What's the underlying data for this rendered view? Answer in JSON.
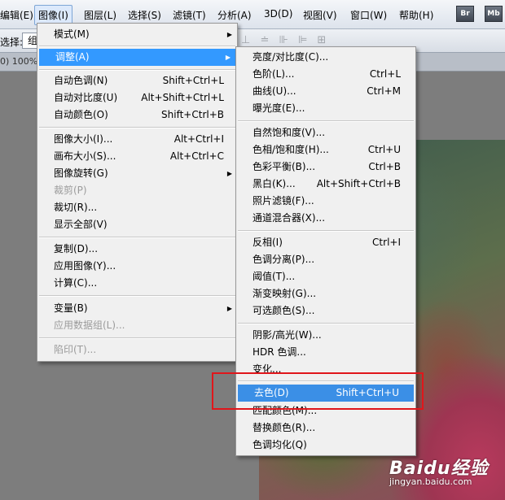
{
  "menubar": {
    "items": [
      "编辑(E)",
      "图像(I)",
      "图层(L)",
      "选择(S)",
      "滤镜(T)",
      "分析(A)",
      "3D(D)",
      "视图(V)",
      "窗口(W)",
      "帮助(H)"
    ],
    "icons": [
      "Br",
      "Mb"
    ]
  },
  "optbar": {
    "label": "选择:",
    "select_value": "组"
  },
  "tabstrip": {
    "zoom": "0) 100%"
  },
  "image_menu": {
    "items": [
      {
        "label": "模式(M)",
        "submenu": true
      },
      {
        "label": "调整(A)",
        "submenu": true,
        "highlighted": true
      },
      {
        "label": "自动色调(N)",
        "shortcut": "Shift+Ctrl+L"
      },
      {
        "label": "自动对比度(U)",
        "shortcut": "Alt+Shift+Ctrl+L"
      },
      {
        "label": "自动颜色(O)",
        "shortcut": "Shift+Ctrl+B"
      },
      {
        "label": "图像大小(I)...",
        "shortcut": "Alt+Ctrl+I"
      },
      {
        "label": "画布大小(S)...",
        "shortcut": "Alt+Ctrl+C"
      },
      {
        "label": "图像旋转(G)",
        "submenu": true
      },
      {
        "label": "裁剪(P)",
        "disabled": true
      },
      {
        "label": "裁切(R)..."
      },
      {
        "label": "显示全部(V)"
      },
      {
        "label": "复制(D)..."
      },
      {
        "label": "应用图像(Y)..."
      },
      {
        "label": "计算(C)..."
      },
      {
        "label": "变量(B)",
        "submenu": true
      },
      {
        "label": "应用数据组(L)...",
        "disabled": true
      },
      {
        "label": "陷印(T)...",
        "disabled": true
      }
    ]
  },
  "adjust_menu": {
    "items": [
      {
        "label": "亮度/对比度(C)..."
      },
      {
        "label": "色阶(L)...",
        "shortcut": "Ctrl+L"
      },
      {
        "label": "曲线(U)...",
        "shortcut": "Ctrl+M"
      },
      {
        "label": "曝光度(E)..."
      },
      {
        "label": "自然饱和度(V)..."
      },
      {
        "label": "色相/饱和度(H)...",
        "shortcut": "Ctrl+U"
      },
      {
        "label": "色彩平衡(B)...",
        "shortcut": "Ctrl+B"
      },
      {
        "label": "黑白(K)...",
        "shortcut": "Alt+Shift+Ctrl+B"
      },
      {
        "label": "照片滤镜(F)..."
      },
      {
        "label": "通道混合器(X)..."
      },
      {
        "label": "反相(I)",
        "shortcut": "Ctrl+I"
      },
      {
        "label": "色调分离(P)..."
      },
      {
        "label": "阈值(T)..."
      },
      {
        "label": "渐变映射(G)..."
      },
      {
        "label": "可选颜色(S)..."
      },
      {
        "label": "阴影/高光(W)..."
      },
      {
        "label": "HDR 色调..."
      },
      {
        "label": "变化..."
      },
      {
        "label": "去色(D)",
        "shortcut": "Shift+Ctrl+U",
        "highlighted": true
      },
      {
        "label": "匹配颜色(M)..."
      },
      {
        "label": "替换颜色(R)..."
      },
      {
        "label": "色调均化(Q)"
      }
    ]
  },
  "watermark": {
    "brand": "Baidu经验",
    "url": "jingyan.baidu.com"
  },
  "colors": {
    "highlight": "#3399ff",
    "annotation": "#e0161b"
  }
}
